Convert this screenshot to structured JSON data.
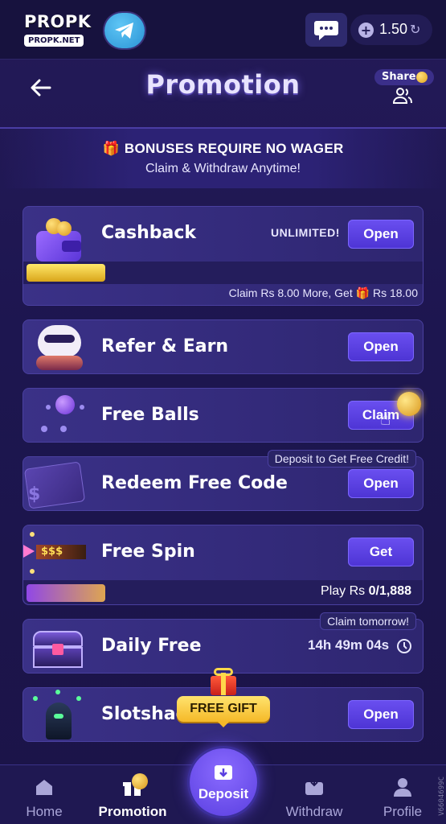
{
  "topbar": {
    "logo_text": "PROPK",
    "logo_sub": "PROPK.NET",
    "balance": "1.50"
  },
  "header": {
    "title": "Promotion",
    "share_label": "Share"
  },
  "banner": {
    "line1": "BONUSES REQUIRE NO WAGER",
    "line2": "Claim & Withdraw Anytime!"
  },
  "cards": {
    "cashback": {
      "title": "Cashback",
      "badge": "UNLIMITED!",
      "button": "Open",
      "progress": 0.2,
      "note_prefix": "Claim Rs 8.00 More, Get",
      "note_suffix": "Rs 18.00"
    },
    "refer": {
      "title": "Refer & Earn",
      "button": "Open"
    },
    "balls": {
      "title": "Free Balls",
      "button": "Claim"
    },
    "redeem": {
      "title": "Redeem Free Code",
      "button": "Open",
      "tag": "Deposit to Get Free Credit!"
    },
    "spin": {
      "title": "Free Spin",
      "button": "Get",
      "icon_text": "$$$",
      "progress": 0.0,
      "play_label": "Play Rs",
      "play_value": "0/1,888"
    },
    "daily": {
      "title": "Daily Free",
      "timer": "14h 49m 04s",
      "tag": "Claim tomorrow!"
    },
    "slots": {
      "title": "Slotshac",
      "button": "Open",
      "gift_label": "FREE GIFT"
    }
  },
  "footer": {
    "home": "Home",
    "promotion": "Promotion",
    "deposit": "Deposit",
    "withdraw": "Withdraw",
    "profile": "Profile"
  },
  "side_id": "V6604699C"
}
